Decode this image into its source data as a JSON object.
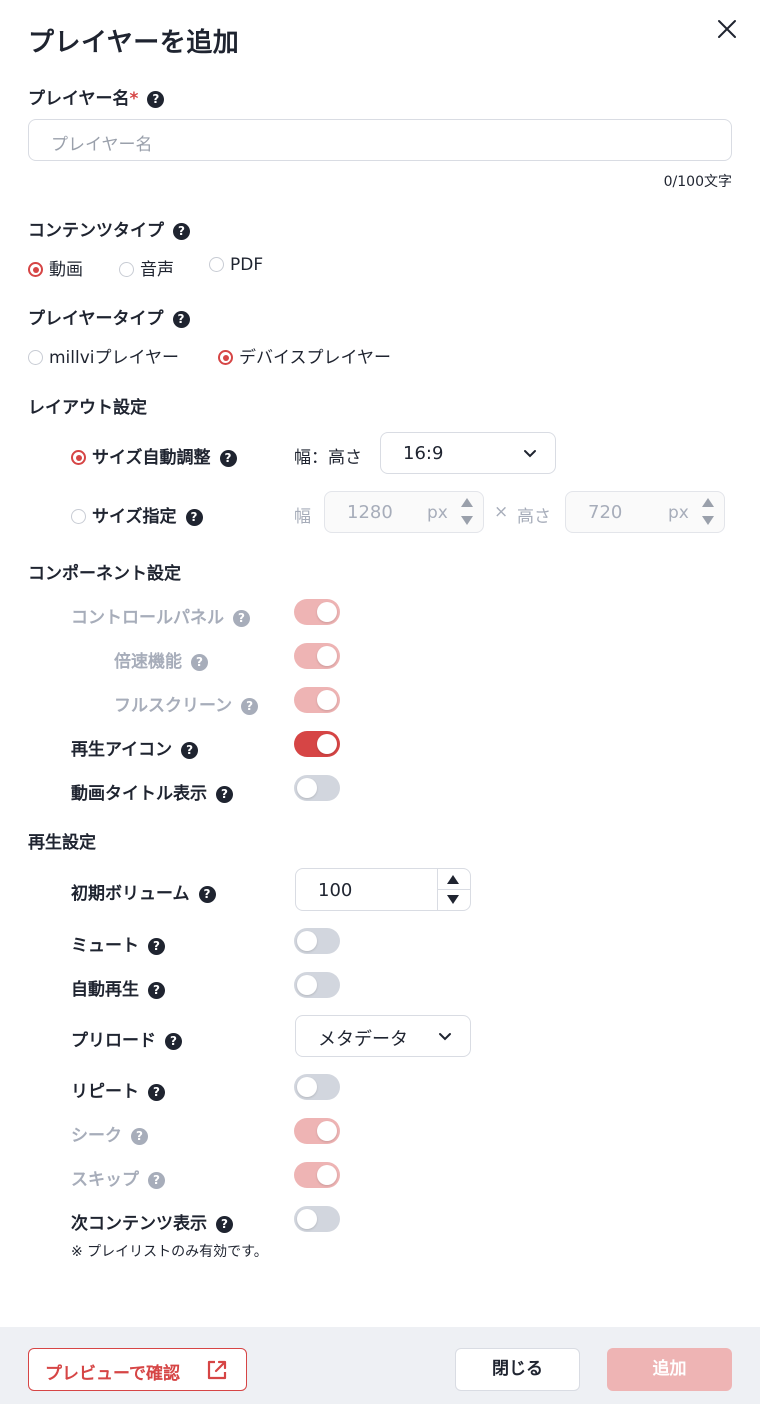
{
  "dialog": {
    "title": "プレイヤーを追加"
  },
  "help_glyph": "?",
  "player_name": {
    "label": "プレイヤー名",
    "required_mark": "*",
    "placeholder": "プレイヤー名",
    "value": "",
    "counter": "0/100文字"
  },
  "content_type": {
    "label": "コンテンツタイプ",
    "options": [
      "動画",
      "音声",
      "PDF"
    ],
    "selected": "動画"
  },
  "player_type": {
    "label": "プレイヤータイプ",
    "options": [
      "millviプレイヤー",
      "デバイスプレイヤー"
    ],
    "selected": "デバイスプレイヤー"
  },
  "layout": {
    "label": "レイアウト設定",
    "auto": {
      "label": "サイズ自動調整",
      "selected": true,
      "ratio_label": "幅：高さ",
      "ratio_value": "16:9"
    },
    "manual": {
      "label": "サイズ指定",
      "selected": false,
      "width_label": "幅",
      "width_value": "1280",
      "unit": "px",
      "times": "×",
      "height_label": "高さ",
      "height_value": "720"
    }
  },
  "components": {
    "label": "コンポーネント設定",
    "items": [
      {
        "label": "コントロールパネル",
        "on": true,
        "disabled": true
      },
      {
        "label": "倍速機能",
        "on": true,
        "disabled": true
      },
      {
        "label": "フルスクリーン",
        "on": true,
        "disabled": true
      },
      {
        "label": "再生アイコン",
        "on": true,
        "disabled": false
      },
      {
        "label": "動画タイトル表示",
        "on": false,
        "disabled": false
      }
    ]
  },
  "playback": {
    "label": "再生設定",
    "initial_volume": {
      "label": "初期ボリューム",
      "value": "100"
    },
    "mute": {
      "label": "ミュート",
      "on": false
    },
    "autoplay": {
      "label": "自動再生",
      "on": false
    },
    "preload": {
      "label": "プリロード",
      "value": "メタデータ"
    },
    "repeat": {
      "label": "リピート",
      "on": false
    },
    "seek": {
      "label": "シーク",
      "on": true,
      "disabled": true
    },
    "skip": {
      "label": "スキップ",
      "on": true,
      "disabled": true
    },
    "next_content": {
      "label": "次コンテンツ表示",
      "on": false
    },
    "note": "※ プレイリストのみ有効です。"
  },
  "footer": {
    "preview_label": "プレビューで確認",
    "close_label": "閉じる",
    "add_label": "追加"
  },
  "colors": {
    "accent": "#d64545",
    "accent_disabled": "#eeb4b4",
    "toggle_off": "#d2d6de",
    "footer_bg": "#eef0f4",
    "text": "#1f2430",
    "muted": "#a7adba"
  }
}
